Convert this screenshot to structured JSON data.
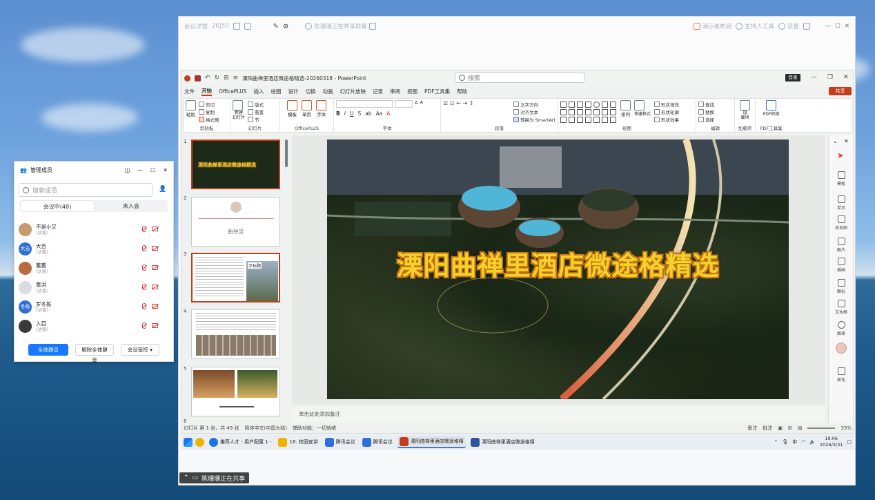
{
  "meeting_bar": {
    "meeting_info": "会议详情",
    "network": "26|50",
    "sharing_status": "陈珊珊正在共享屏幕",
    "tools": [
      {
        "label": "演示者布局",
        "icon": "layout-icon"
      },
      {
        "label": "主持人工具",
        "icon": "host-tools-icon"
      },
      {
        "label": "设置",
        "icon": "settings-icon"
      }
    ]
  },
  "ppt": {
    "app": "PowerPoint",
    "doc_title": "溧阳曲禅里酒店微途格精选-20260318",
    "search_placeholder": "搜索",
    "login_label": "登录",
    "share_label": "共享",
    "menu": [
      "文件",
      "开始",
      "OfficePLUS",
      "插入",
      "绘图",
      "设计",
      "切换",
      "动画",
      "幻灯片放映",
      "记录",
      "审阅",
      "视图",
      "PDF工具集",
      "帮助"
    ],
    "active_menu": "开始",
    "ribbon": {
      "clipboard": {
        "label": "剪贴板",
        "paste": "粘贴",
        "cut": "剪切",
        "copy": "复制",
        "format_painter": "格式刷"
      },
      "slides": {
        "label": "幻灯片",
        "new_slide": "新建\n幻灯片",
        "layout": "版式",
        "reset": "重置",
        "section": "节"
      },
      "officeplus": {
        "label": "OfficePLUS",
        "template": "模板",
        "single_page": "单页",
        "font": "字体"
      },
      "font": {
        "label": "字体"
      },
      "paragraph": {
        "label": "段落",
        "text_direction": "文字方向",
        "align_text": "对齐文本",
        "smartart": "转换为 SmartArt"
      },
      "drawing": {
        "label": "绘图",
        "arrange": "排列",
        "quick_styles": "快速样式",
        "fill": "形状填充",
        "outline": "形状轮廓",
        "effects": "形状效果"
      },
      "editing": {
        "label": "编辑",
        "find": "查找",
        "replace": "替换",
        "select": "选择"
      },
      "addins": {
        "label": "加载项",
        "addins_btn": "加\n载项"
      },
      "pdf": {
        "label": "PDF工具集",
        "pdf_convert": "PDF转换"
      }
    },
    "slides": [
      {
        "num": "1",
        "caption": "溧阳曲禅里酒店微途格精选"
      },
      {
        "num": "2",
        "caption": "曲禅里"
      },
      {
        "num": "3",
        "caption": "示标题"
      },
      {
        "num": "4",
        "caption": ""
      },
      {
        "num": "5",
        "caption": ""
      },
      {
        "num": "6",
        "caption": ""
      }
    ],
    "main_slide_title": "溧阳曲禅里酒店微途格精选",
    "notes_placeholder": "单击此处添加备注",
    "side_panel": [
      "模板",
      "单页",
      "关系图",
      "图片",
      "插画",
      "图标",
      "文本框",
      "图表",
      "",
      "美化"
    ],
    "status": {
      "slide_count": "幻灯片 第 1 张，共 49 张",
      "language": "简体中文(中国大陆)",
      "accessibility": "辅助功能：一切就绪",
      "notes": "备注",
      "comments": "批注",
      "zoom": "33%"
    }
  },
  "taskbar": {
    "tasks": [
      {
        "label": "推荐人才 - 用户配置 1 -",
        "color": "#1a73e8"
      },
      {
        "label": "16. 校园宣讲",
        "color": "#f0b400"
      },
      {
        "label": "腾讯会议",
        "color": "#2f6fdc"
      },
      {
        "label": "腾讯会议",
        "color": "#2f6fdc"
      },
      {
        "label": "溧阳曲禅里酒店微途格精",
        "color": "#c43e1c"
      },
      {
        "label": "溧阳曲禅里酒店微途格精",
        "color": "#2b579a"
      }
    ],
    "ime": "中",
    "time": "19:06",
    "date": "2026/3/31"
  },
  "share_tip": "陈珊珊正在共享",
  "members": {
    "title": "管理成员",
    "search_placeholder": "搜索成员",
    "tab_in_meeting": "会议中(48)",
    "tab_not_joined": "未入会",
    "list": [
      {
        "name": "不是小又",
        "role": "(访客)",
        "avatar": "",
        "color": "#c99a6b"
      },
      {
        "name": "大吉",
        "role": "(访客)",
        "avatar": "大吉",
        "color": "#2f6fdc"
      },
      {
        "name": "蓄蓄",
        "role": "(访客)",
        "avatar": "",
        "color": "#b86b3f"
      },
      {
        "name": "章洪",
        "role": "(访客)",
        "avatar": "",
        "color": "#d9dde3"
      },
      {
        "name": "罗冬栋",
        "role": "(访客)",
        "avatar": "冬栋",
        "color": "#2f6fdc"
      },
      {
        "name": "入目",
        "role": "(访客)",
        "avatar": "",
        "color": "#3a3a3a"
      }
    ],
    "btn_mute_all": "全体静音",
    "btn_unmute_all": "解除全体静音",
    "btn_controls": "会议管控"
  }
}
